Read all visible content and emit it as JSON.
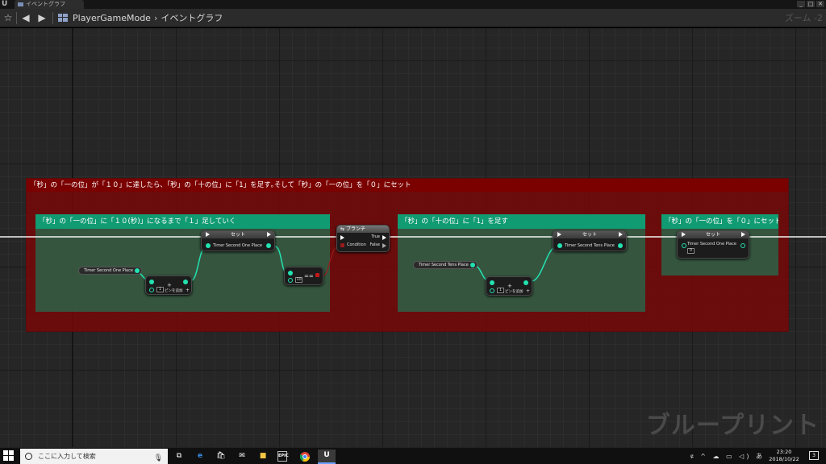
{
  "titlebar": {
    "logo": "U",
    "tab_label": "イベントグラフ",
    "min_label": "_",
    "max_label": "□",
    "close_label": "✕"
  },
  "toolbar": {
    "breadcrumb": [
      "PlayerGameMode",
      "イベントグラフ"
    ],
    "zoom": "ズーム -2"
  },
  "graph": {
    "watermark": "ブループリント",
    "comments": {
      "outer": "「秒」の「一の位」が「１０」に達したら､「秒」の「十の位」に「1」を足す｡そして「秒」の「一の位」を「０」にセット",
      "c1": "「秒」の「一の位」に「１０(秒)」になるまで「１」足していく",
      "c2": "「秒」の「十の位」に「1」を足す",
      "c3": "「秒」の「一の位」を「０」にセット"
    },
    "nodes": {
      "getter1": "Timer Second One Place",
      "add1": {
        "value": "1",
        "add_pin": "ピンを追加",
        "plus": "+"
      },
      "set1": {
        "title": "セット",
        "var": "Timer Second One Place"
      },
      "eq1": {
        "op": "==",
        "value": "10"
      },
      "branch": {
        "title": "ブランチ",
        "true": "True",
        "false": "False",
        "condition": "Condition"
      },
      "getter2": "Timer Second Tens Place",
      "add2": {
        "value": "1",
        "add_pin": "ピンを追加",
        "plus": "+"
      },
      "set2": {
        "title": "セット",
        "var": "Timer Second Tens Place"
      },
      "set3": {
        "title": "セット",
        "var": "Timer Second One Place",
        "value": "0"
      }
    }
  },
  "taskbar": {
    "search_placeholder": "ここに入力して検索",
    "apps": [
      "task-view",
      "edge",
      "store",
      "mail",
      "explorer",
      "epic",
      "chrome",
      "unreal"
    ],
    "epic_label": "EPIC",
    "time": "23:20",
    "date": "2018/10/22",
    "tray": "ዩ ^ ☁ ▭ ◁) あ",
    "notif": "3"
  },
  "colors": {
    "comment_outer": "#7b0000",
    "comment_inner": "#119b72",
    "exec_wire": "#ffffff",
    "data_wire": "#23e2b1"
  }
}
